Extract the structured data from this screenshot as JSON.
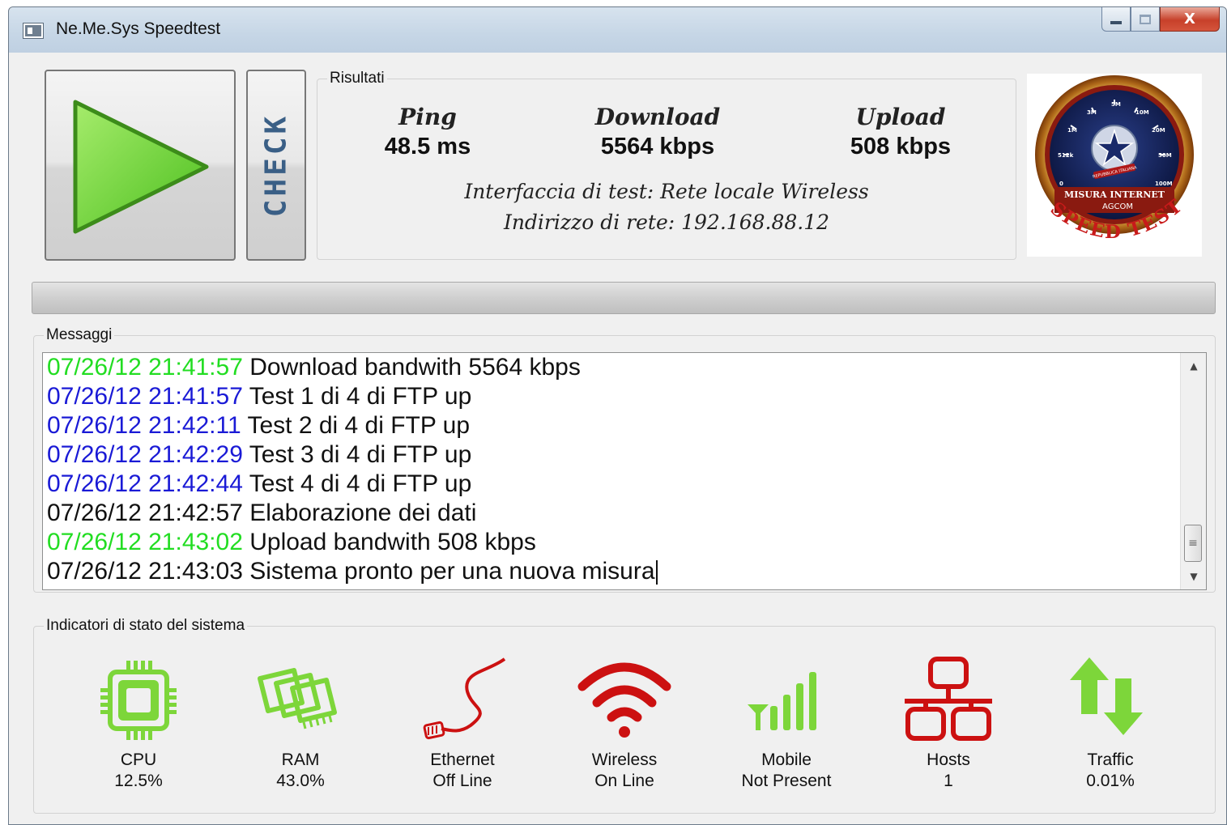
{
  "window": {
    "title": "Ne.Me.Sys Speedtest",
    "controls": {
      "minimize": "minimize-icon",
      "maximize": "maximize-icon",
      "close": "X"
    }
  },
  "buttons": {
    "play_icon": "play-icon",
    "check_label": "CHECK"
  },
  "results": {
    "group_label": "Risultati",
    "ping": {
      "label": "Ping",
      "value": "48.5 ms"
    },
    "download": {
      "label": "Download",
      "value": "5564 kbps"
    },
    "upload": {
      "label": "Upload",
      "value": "508 kbps"
    },
    "interface_line": "Interfaccia di test: Rete locale Wireless",
    "address_line": "Indirizzo di rete: 192.168.88.12"
  },
  "logo": {
    "text_top": "MISURA INTERNET",
    "text_agcom": "AGCOM",
    "text_speed": "SPEED TEST",
    "seal_text": "REPUBBLICA ITALIANA",
    "dial_labels": [
      "0",
      "512k",
      "1M",
      "3M",
      "5M",
      "10M",
      "20M",
      "50M",
      "100M"
    ]
  },
  "progress": {
    "value_fraction": 0
  },
  "messages": {
    "group_label": "Messaggi",
    "colors": {
      "green": "#22dd22",
      "blue": "#1a1ad6",
      "black": "#111111"
    },
    "lines": [
      {
        "timestamp": "07/26/12 21:41:57",
        "text": "Download bandwith 5564 kbps",
        "color": "green"
      },
      {
        "timestamp": "07/26/12 21:41:57",
        "text": "Test 1 di 4 di FTP up",
        "color": "blue"
      },
      {
        "timestamp": "07/26/12 21:42:11",
        "text": "Test 2 di 4 di FTP up",
        "color": "blue"
      },
      {
        "timestamp": "07/26/12 21:42:29",
        "text": "Test 3 di 4 di FTP up",
        "color": "blue"
      },
      {
        "timestamp": "07/26/12 21:42:44",
        "text": "Test 4 di 4 di FTP up",
        "color": "blue"
      },
      {
        "timestamp": "07/26/12 21:42:57",
        "text": "Elaborazione dei dati",
        "color": "black"
      },
      {
        "timestamp": "07/26/12 21:43:02",
        "text": "Upload bandwith 508 kbps",
        "color": "green"
      },
      {
        "timestamp": "07/26/12 21:43:03",
        "text": "Sistema pronto per una nuova misura",
        "color": "black"
      }
    ]
  },
  "indicators": {
    "group_label": "Indicatori di stato del sistema",
    "colors": {
      "ok": "#7dd63a",
      "error": "#cc1111"
    },
    "items": [
      {
        "name": "CPU",
        "value": "12.5%",
        "icon": "cpu-icon",
        "status": "ok"
      },
      {
        "name": "RAM",
        "value": "43.0%",
        "icon": "ram-icon",
        "status": "ok"
      },
      {
        "name": "Ethernet",
        "value": "Off Line",
        "icon": "ethernet-cable-icon",
        "status": "error"
      },
      {
        "name": "Wireless",
        "value": "On Line",
        "icon": "wifi-icon",
        "status": "error"
      },
      {
        "name": "Mobile",
        "value": "Not Present",
        "icon": "signal-bars-icon",
        "status": "ok"
      },
      {
        "name": "Hosts",
        "value": "1",
        "icon": "network-hosts-icon",
        "status": "error"
      },
      {
        "name": "Traffic",
        "value": "0.01%",
        "icon": "traffic-arrows-icon",
        "status": "ok"
      }
    ]
  }
}
